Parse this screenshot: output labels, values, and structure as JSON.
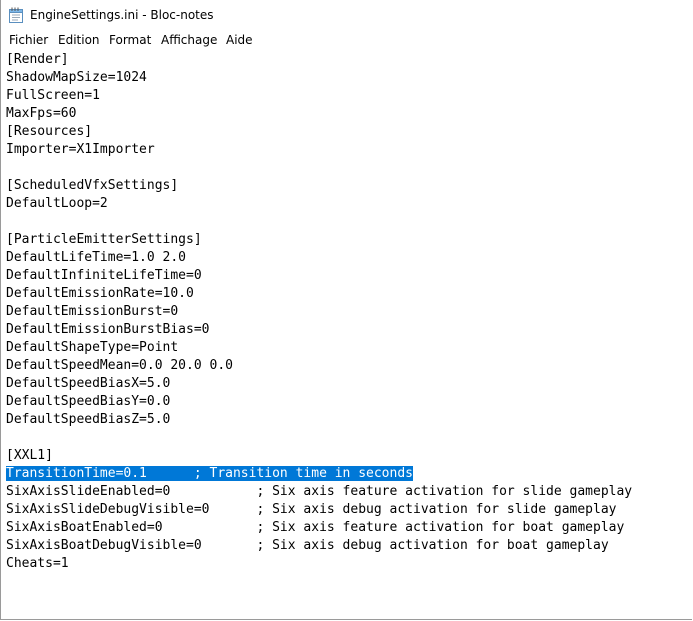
{
  "window": {
    "title": "EngineSettings.ini - Bloc-notes"
  },
  "icons": {
    "app": "notepad-icon"
  },
  "menu": {
    "items": [
      {
        "label": "Fichier"
      },
      {
        "label": "Edition"
      },
      {
        "label": "Format"
      },
      {
        "label": "Affichage"
      },
      {
        "label": "Aide"
      }
    ]
  },
  "editor": {
    "selection_color": "#0078d7",
    "lines": [
      "[Render]",
      "ShadowMapSize=1024",
      "FullScreen=1",
      "MaxFps=60",
      "[Resources]",
      "Importer=X1Importer",
      "",
      "[ScheduledVfxSettings]",
      "DefaultLoop=2",
      "",
      "[ParticleEmitterSettings]",
      "DefaultLifeTime=1.0 2.0",
      "DefaultInfiniteLifeTime=0",
      "DefaultEmissionRate=10.0",
      "DefaultEmissionBurst=0",
      "DefaultEmissionBurstBias=0",
      "DefaultShapeType=Point",
      "DefaultSpeedMean=0.0 20.0 0.0",
      "DefaultSpeedBiasX=5.0",
      "DefaultSpeedBiasY=0.0",
      "DefaultSpeedBiasZ=5.0",
      "",
      "[XXL1]",
      "TransitionTime=0.1      ; Transition time in seconds",
      "SixAxisSlideEnabled=0           ; Six axis feature activation for slide gameplay",
      "SixAxisSlideDebugVisible=0      ; Six axis debug activation for slide gameplay",
      "SixAxisBoatEnabled=0            ; Six axis feature activation for boat gameplay",
      "SixAxisBoatDebugVisible=0       ; Six axis debug activation for boat gameplay",
      "Cheats=1"
    ],
    "selected_line_index": 23
  }
}
